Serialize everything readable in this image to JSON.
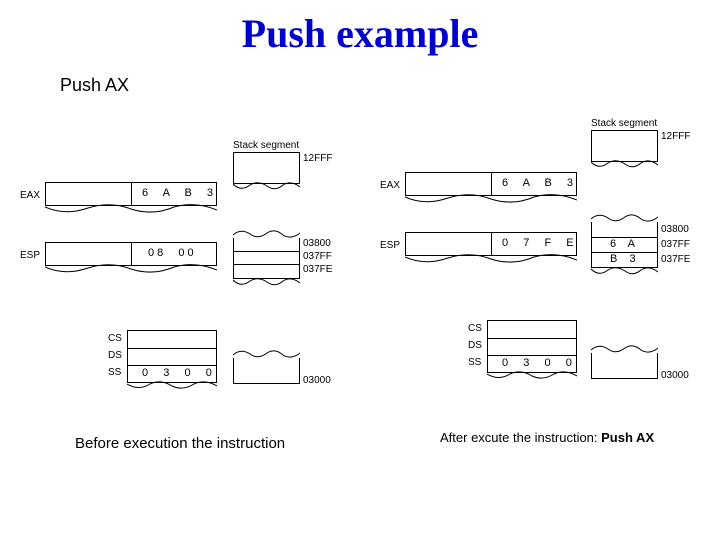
{
  "title": "Push example",
  "subtitle": "Push AX",
  "before_caption": "Before execution the instruction",
  "after_caption_prefix": "After excute the instruction: ",
  "after_caption_instr": "Push AX",
  "labels": {
    "stack_segment": "Stack segment",
    "eax": "EAX",
    "esp": "ESP",
    "cs": "CS",
    "ds": "DS",
    "ss": "SS"
  },
  "addr": {
    "a12FFF": "12FFF",
    "a03800": "03800",
    "a037FF": "037FF",
    "a037FE": "037FE",
    "a03000": "03000"
  },
  "before": {
    "eax": "6  A  B  3",
    "esp": "08  00",
    "ss": "0  3  0  0"
  },
  "after": {
    "eax": "6  A  B  3",
    "esp": "0  7  F  E",
    "ss": "0  3  0  0",
    "mem037FF": "6  A",
    "mem037FE": "B  3"
  }
}
